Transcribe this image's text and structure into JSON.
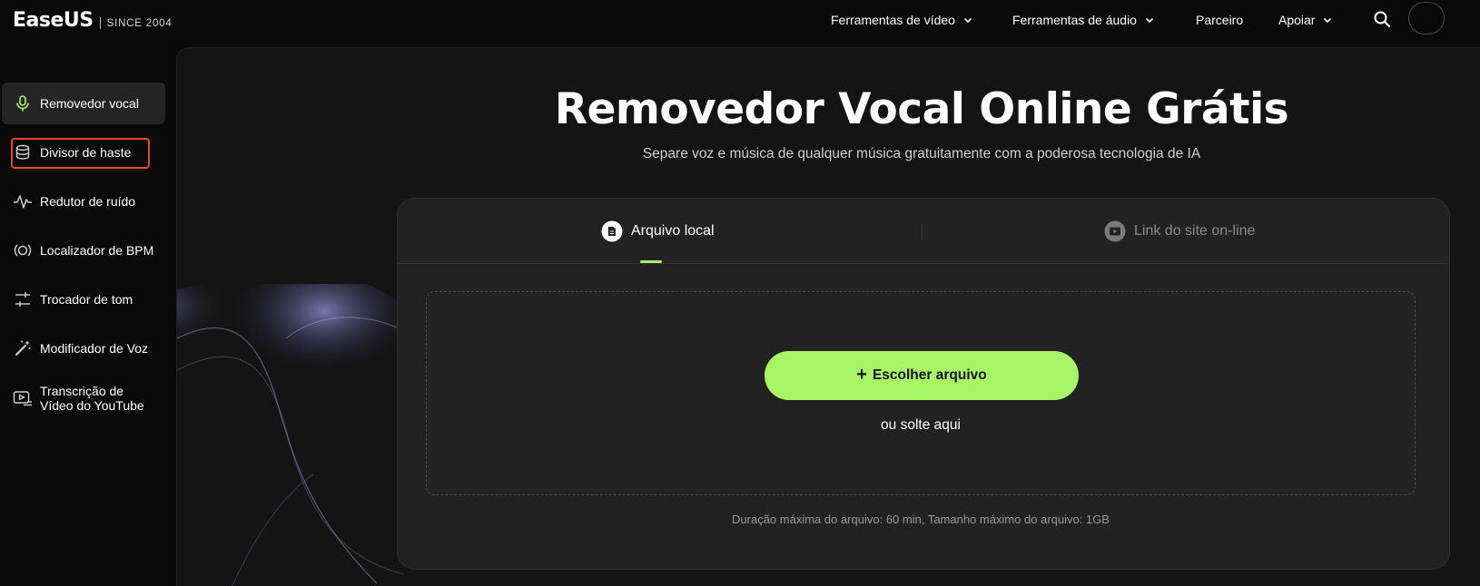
{
  "brand": {
    "logo": "EaseUS",
    "since": "SINCE 2004"
  },
  "nav": {
    "video_tools": "Ferramentas de vídeo",
    "audio_tools": "Ferramentas de áudio",
    "partner": "Parceiro",
    "support": "Apoiar",
    "search_icon": "search-icon"
  },
  "sidebar": {
    "items": [
      {
        "label": "Removedor vocal",
        "icon": "microphone-icon",
        "active": true
      },
      {
        "label": "Divisor de haste",
        "icon": "stem-splitter-icon",
        "active": false
      },
      {
        "label": "Redutor de ruído",
        "icon": "waveform-icon",
        "active": false
      },
      {
        "label": "Localizador de BPM",
        "icon": "bpm-icon",
        "active": false
      },
      {
        "label": "Trocador de tom",
        "icon": "sliders-icon",
        "active": false
      },
      {
        "label": "Modificador de Voz",
        "icon": "magic-wand-icon",
        "active": false
      },
      {
        "label": "Transcrição de Vídeo do YouTube",
        "label_line1": "Transcrição de",
        "label_line2": "Vídeo do YouTube",
        "icon": "youtube-transcript-icon",
        "active": false
      }
    ]
  },
  "hero": {
    "title": "Removedor Vocal Online Grátis",
    "subtitle": "Separe voz e música de qualquer música gratuitamente com a poderosa tecnologia de IA"
  },
  "upload": {
    "tab_local": "Arquivo local",
    "tab_link": "Link do site on-line",
    "choose_button": "Escolher arquivo",
    "drop_hint": "ou solte aqui",
    "limits": "Duração máxima do arquivo: 60 min, Tamanho máximo do arquivo: 1GB"
  },
  "colors": {
    "accent": "#a6f564",
    "highlight": "#e5462f",
    "background": "#0a0a0a",
    "card": "#222222"
  }
}
